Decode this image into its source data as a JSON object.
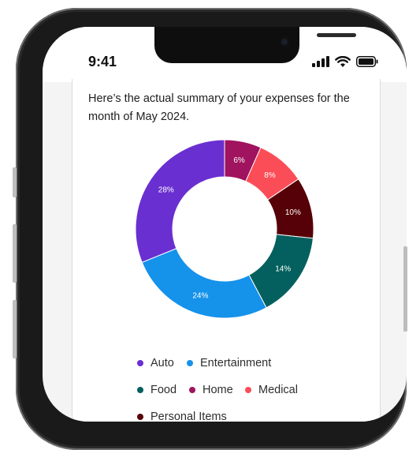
{
  "status_bar": {
    "time": "9:41"
  },
  "summary_text": "Here’s the actual summary of your expenses for the month of May 2024.",
  "colors": {
    "auto": "#6a2fd0",
    "entertainment": "#1592ea",
    "food": "#03605e",
    "home": "#a0135f",
    "medical": "#fb4d57",
    "personal_items": "#560007"
  },
  "chart_data": {
    "type": "pie",
    "variant": "donut",
    "title": "",
    "categories": [
      "Home",
      "Medical",
      "Personal Items",
      "Food",
      "Entertainment",
      "Auto"
    ],
    "values": [
      6,
      8,
      10,
      14,
      24,
      28
    ],
    "value_labels": [
      "6%",
      "8%",
      "10%",
      "14%",
      "24%",
      "28%"
    ],
    "colors": [
      "#a0135f",
      "#fb4d57",
      "#560007",
      "#03605e",
      "#1592ea",
      "#6a2fd0"
    ],
    "unit": "%",
    "legend_position": "bottom",
    "legend": [
      "Auto",
      "Entertainment",
      "Food",
      "Home",
      "Medical",
      "Personal Items"
    ]
  }
}
